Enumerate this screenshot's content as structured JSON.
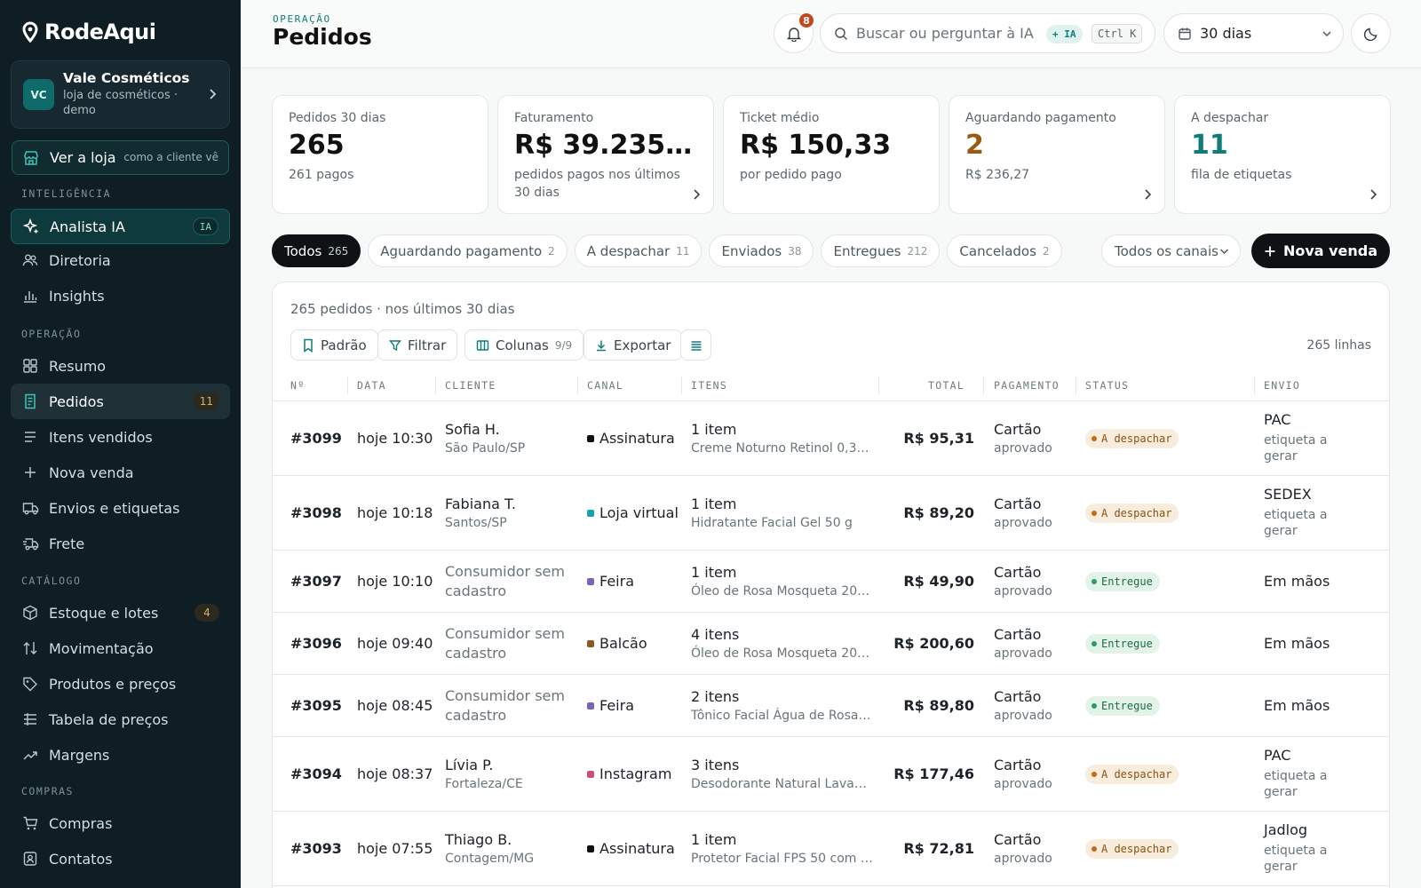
{
  "brand": {
    "name": "RodeAqui"
  },
  "store": {
    "initials": "VC",
    "name": "Vale Cosméticos",
    "subtitle": "loja de cosméticos · demo"
  },
  "see_shop": {
    "label": "Ver a loja",
    "hint": "como a cliente vê"
  },
  "sidebar": {
    "sections": {
      "intel": "INTELIGÊNCIA",
      "ops": "OPERAÇÃO",
      "catalog": "CATÁLOGO",
      "purchases": "COMPRAS"
    },
    "items": [
      {
        "label": "Analista IA",
        "badge": "IA",
        "icon": "sparkle-icon"
      },
      {
        "label": "Diretoria",
        "icon": "users-icon"
      },
      {
        "label": "Insights",
        "icon": "bar-chart-icon"
      },
      {
        "label": "Resumo",
        "icon": "grid-icon"
      },
      {
        "label": "Pedidos",
        "badge": "11",
        "icon": "receipt-icon"
      },
      {
        "label": "Itens vendidos",
        "icon": "list-icon"
      },
      {
        "label": "Nova venda",
        "icon": "plus-icon"
      },
      {
        "label": "Envios e etiquetas",
        "icon": "truck-icon"
      },
      {
        "label": "Frete",
        "icon": "truck-fast-icon"
      },
      {
        "label": "Estoque e lotes",
        "badge": "4",
        "icon": "box-icon"
      },
      {
        "label": "Movimentação",
        "icon": "arrows-icon"
      },
      {
        "label": "Produtos e preços",
        "icon": "tag-icon"
      },
      {
        "label": "Tabela de preços",
        "icon": "table-icon"
      },
      {
        "label": "Margens",
        "icon": "trend-icon"
      },
      {
        "label": "Compras",
        "icon": "cart-icon"
      },
      {
        "label": "Contatos",
        "icon": "contact-icon"
      }
    ]
  },
  "header": {
    "eyebrow": "OPERAÇÃO",
    "title": "Pedidos",
    "notifications": "8",
    "search_placeholder": "Buscar ou perguntar à IA",
    "search_ia": "+ IA",
    "search_shortcut": "Ctrl K",
    "range": "30 dias"
  },
  "kpis": [
    {
      "label": "Pedidos 30 dias",
      "value": "265",
      "sub": "261 pagos"
    },
    {
      "label": "Faturamento",
      "value": "R$ 39.235,…",
      "sub": "pedidos pagos nos últimos 30 dias"
    },
    {
      "label": "Ticket médio",
      "value": "R$ 150,33",
      "sub": "por pedido pago"
    },
    {
      "label": "Aguardando pagamento",
      "value": "2",
      "sub": "R$ 236,27"
    },
    {
      "label": "A despachar",
      "value": "11",
      "sub": "fila de etiquetas"
    }
  ],
  "kpi_colors": {
    "waiting": "#9a5a12",
    "dispatch": "#0f7c78"
  },
  "tabs": [
    {
      "label": "Todos",
      "count": "265"
    },
    {
      "label": "Aguardando pagamento",
      "count": "2"
    },
    {
      "label": "A despachar",
      "count": "11"
    },
    {
      "label": "Enviados",
      "count": "38"
    },
    {
      "label": "Entregues",
      "count": "212"
    },
    {
      "label": "Cancelados",
      "count": "2"
    }
  ],
  "channel_filter": "Todos os canais",
  "new_sale": "Nova venda",
  "table": {
    "count_text": "265 pedidos · nos últimos 30 dias",
    "toolbar": {
      "preset": "Padrão",
      "filter": "Filtrar",
      "columns": "Colunas",
      "columns_meta": "9/9",
      "export": "Exportar"
    },
    "lines": "265 linhas",
    "headers": [
      "Nº",
      "DATA",
      "CLIENTE",
      "CANAL",
      "ITENS",
      "TOTAL",
      "PAGAMENTO",
      "STATUS",
      "ENVIO"
    ],
    "rows": [
      {
        "id": "#3099",
        "date": "hoje 10:30",
        "client": "Sofia H.",
        "city": "São Paulo/SP",
        "channel": "Assinatura",
        "items": "1 item",
        "item_desc": "Creme Noturno Retinol 0,3%…",
        "total": "R$ 95,31",
        "pay": "Cartão",
        "pay_sub": "aprovado",
        "status": "A despachar",
        "ship": "PAC",
        "ship_sub": "etiqueta a gerar"
      },
      {
        "id": "#3098",
        "date": "hoje 10:18",
        "client": "Fabiana T.",
        "city": "Santos/SP",
        "channel": "Loja virtual",
        "items": "1 item",
        "item_desc": "Hidratante Facial Gel 50 g",
        "total": "R$ 89,20",
        "pay": "Cartão",
        "pay_sub": "aprovado",
        "status": "A despachar",
        "ship": "SEDEX",
        "ship_sub": "etiqueta a gerar"
      },
      {
        "id": "#3097",
        "date": "hoje 10:10",
        "client": "Consumidor sem cadastro",
        "city": "",
        "channel": "Feira",
        "items": "1 item",
        "item_desc": "Óleo de Rosa Mosqueta 20 ml",
        "total": "R$ 49,90",
        "pay": "Cartão",
        "pay_sub": "aprovado",
        "status": "Entregue",
        "ship": "Em mãos",
        "ship_sub": ""
      },
      {
        "id": "#3096",
        "date": "hoje 09:40",
        "client": "Consumidor sem cadastro",
        "city": "",
        "channel": "Balcão",
        "items": "4 itens",
        "item_desc": "Óleo de Rosa Mosqueta 20 …",
        "total": "R$ 200,60",
        "pay": "Cartão",
        "pay_sub": "aprovado",
        "status": "Entregue",
        "ship": "Em mãos",
        "ship_sub": ""
      },
      {
        "id": "#3095",
        "date": "hoje 08:45",
        "client": "Consumidor sem cadastro",
        "city": "",
        "channel": "Feira",
        "items": "2 itens",
        "item_desc": "Tônico Facial Água de Rosas …",
        "total": "R$ 89,80",
        "pay": "Cartão",
        "pay_sub": "aprovado",
        "status": "Entregue",
        "ship": "Em mãos",
        "ship_sub": ""
      },
      {
        "id": "#3094",
        "date": "hoje 08:37",
        "client": "Lívia P.",
        "city": "Fortaleza/CE",
        "channel": "Instagram",
        "items": "3 itens",
        "item_desc": "Desodorante Natural Lavand…",
        "total": "R$ 177,46",
        "pay": "Cartão",
        "pay_sub": "aprovado",
        "status": "A despachar",
        "ship": "PAC",
        "ship_sub": "etiqueta a gerar"
      },
      {
        "id": "#3093",
        "date": "hoje 07:55",
        "client": "Thiago B.",
        "city": "Contagem/MG",
        "channel": "Assinatura",
        "items": "1 item",
        "item_desc": "Protetor Facial FPS 50 com c…",
        "total": "R$ 72,81",
        "pay": "Cartão",
        "pay_sub": "aprovado",
        "status": "A despachar",
        "ship": "Jadlog",
        "ship_sub": "etiqueta a gerar"
      }
    ]
  },
  "channel_colors": {
    "Assinatura": "#111111",
    "Loja virtual": "#14a3b0",
    "Feira": "#7a63b8",
    "Balcão": "#8a5a1e",
    "Instagram": "#cc4d78"
  }
}
